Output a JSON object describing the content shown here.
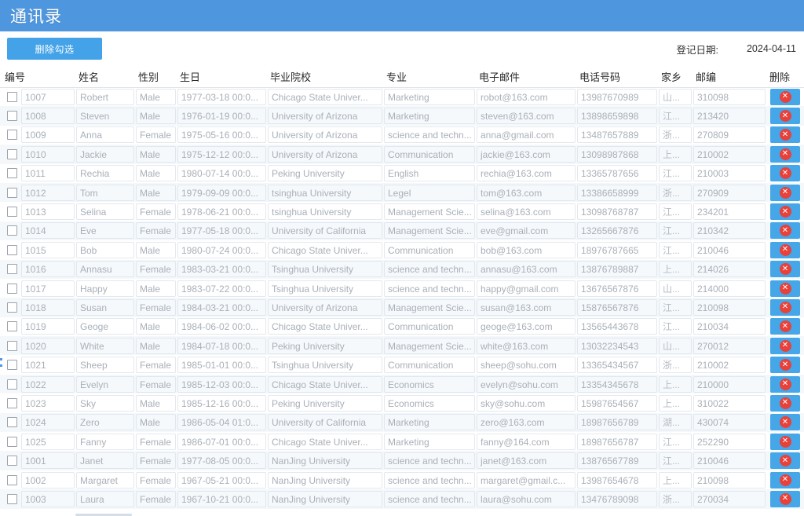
{
  "app": {
    "title": "通讯录",
    "accent_color": "#4e96de",
    "button_color": "#44a3e8",
    "delete_icon_color": "#e8413a"
  },
  "toolbar": {
    "delete_checked_label": "删除勾选",
    "reg_date_label": "登记日期:",
    "reg_date_value": "2024-04-11"
  },
  "table": {
    "columns": [
      {
        "key": "check",
        "label": "编号"
      },
      {
        "key": "name",
        "label": "姓名"
      },
      {
        "key": "gender",
        "label": "性别"
      },
      {
        "key": "birthday",
        "label": "生日"
      },
      {
        "key": "school",
        "label": "毕业院校"
      },
      {
        "key": "major",
        "label": "专业"
      },
      {
        "key": "email",
        "label": "电子邮件"
      },
      {
        "key": "phone",
        "label": "电话号码"
      },
      {
        "key": "hometown",
        "label": "家乡"
      },
      {
        "key": "zip",
        "label": "邮编"
      },
      {
        "key": "delete",
        "label": "删除"
      }
    ],
    "rows": [
      {
        "id": "1007",
        "name": "Robert",
        "gender": "Male",
        "birthday": "1977-03-18 00:0...",
        "school": "Chicago State Univer...",
        "major": "Marketing",
        "email": "robot@163.com",
        "phone": "13987670989",
        "hometown": "山...",
        "zip": "310098"
      },
      {
        "id": "1008",
        "name": "Steven",
        "gender": "Male",
        "birthday": "1976-01-19 00:0...",
        "school": "University of Arizona",
        "major": "Marketing",
        "email": "steven@163.com",
        "phone": "13898659898",
        "hometown": "江...",
        "zip": "213420"
      },
      {
        "id": "1009",
        "name": "Anna",
        "gender": "Female",
        "birthday": "1975-05-16 00:0...",
        "school": "University of Arizona",
        "major": "science and techn...",
        "email": "anna@gmail.com",
        "phone": "13487657889",
        "hometown": "浙...",
        "zip": "270809"
      },
      {
        "id": "1010",
        "name": "Jackie",
        "gender": "Male",
        "birthday": "1975-12-12 00:0...",
        "school": "University of Arizona",
        "major": "Communication",
        "email": "jackie@163.com",
        "phone": "13098987868",
        "hometown": "上...",
        "zip": "210002"
      },
      {
        "id": "1011",
        "name": "Rechia",
        "gender": "Male",
        "birthday": "1980-07-14 00:0...",
        "school": "Peking University",
        "major": "English",
        "email": "rechia@163.com",
        "phone": "13365787656",
        "hometown": "江...",
        "zip": "210003"
      },
      {
        "id": "1012",
        "name": "Tom",
        "gender": "Male",
        "birthday": "1979-09-09 00:0...",
        "school": "tsinghua University",
        "major": "Legel",
        "email": "tom@163.com",
        "phone": "13386658999",
        "hometown": "浙...",
        "zip": "270909"
      },
      {
        "id": "1013",
        "name": "Selina",
        "gender": "Female",
        "birthday": "1978-06-21 00:0...",
        "school": "tsinghua University",
        "major": "Management Scie...",
        "email": "selina@163.com",
        "phone": "13098768787",
        "hometown": "江...",
        "zip": "234201"
      },
      {
        "id": "1014",
        "name": "Eve",
        "gender": "Female",
        "birthday": "1977-05-18 00:0...",
        "school": "University of California",
        "major": "Management Scie...",
        "email": "eve@gmail.com",
        "phone": "13265667876",
        "hometown": "江...",
        "zip": "210342"
      },
      {
        "id": "1015",
        "name": "Bob",
        "gender": "Male",
        "birthday": "1980-07-24 00:0...",
        "school": "Chicago State Univer...",
        "major": "Communication",
        "email": "bob@163.com",
        "phone": "18976787665",
        "hometown": "江...",
        "zip": "210046"
      },
      {
        "id": "1016",
        "name": "Annasu",
        "gender": "Female",
        "birthday": "1983-03-21 00:0...",
        "school": "Tsinghua University",
        "major": "science and techn...",
        "email": "annasu@163.com",
        "phone": "13876789887",
        "hometown": "上...",
        "zip": "214026"
      },
      {
        "id": "1017",
        "name": "Happy",
        "gender": "Male",
        "birthday": "1983-07-22 00:0...",
        "school": "Tsinghua University",
        "major": "science and techn...",
        "email": "happy@gmail.com",
        "phone": "13676567876",
        "hometown": "山...",
        "zip": "214000"
      },
      {
        "id": "1018",
        "name": "Susan",
        "gender": "Female",
        "birthday": "1984-03-21 00:0...",
        "school": "University of Arizona",
        "major": "Management Scie...",
        "email": "susan@163.com",
        "phone": "15876567876",
        "hometown": "江...",
        "zip": "210098"
      },
      {
        "id": "1019",
        "name": "Geoge",
        "gender": "Male",
        "birthday": "1984-06-02 00:0...",
        "school": "Chicago State Univer...",
        "major": "Communication",
        "email": "geoge@163.com",
        "phone": "13565443678",
        "hometown": "江...",
        "zip": "210034"
      },
      {
        "id": "1020",
        "name": "White",
        "gender": "Male",
        "birthday": "1984-07-18 00:0...",
        "school": "Peking University",
        "major": "Management Scie...",
        "email": "white@163.com",
        "phone": "13032234543",
        "hometown": "山...",
        "zip": "270012"
      },
      {
        "id": "1021",
        "name": "Sheep",
        "gender": "Female",
        "birthday": "1985-01-01 00:0...",
        "school": "Tsinghua University",
        "major": "Communication",
        "email": "sheep@sohu.com",
        "phone": "13365434567",
        "hometown": "浙...",
        "zip": "210002"
      },
      {
        "id": "1022",
        "name": "Evelyn",
        "gender": "Female",
        "birthday": "1985-12-03 00:0...",
        "school": "Chicago State Univer...",
        "major": "Economics",
        "email": "evelyn@sohu.com",
        "phone": "13354345678",
        "hometown": "上...",
        "zip": "210000"
      },
      {
        "id": "1023",
        "name": "Sky",
        "gender": "Male",
        "birthday": "1985-12-16 00:0...",
        "school": "Peking University",
        "major": "Economics",
        "email": "sky@sohu.com",
        "phone": "15987654567",
        "hometown": "上...",
        "zip": "310022"
      },
      {
        "id": "1024",
        "name": "Zero",
        "gender": "Male",
        "birthday": "1986-05-04 01:0...",
        "school": "University of California",
        "major": "Marketing",
        "email": "zero@163.com",
        "phone": "18987656789",
        "hometown": "湖...",
        "zip": "430074"
      },
      {
        "id": "1025",
        "name": "Fanny",
        "gender": "Female",
        "birthday": "1986-07-01 00:0...",
        "school": "Chicago State Univer...",
        "major": "Marketing",
        "email": "fanny@164.com",
        "phone": "18987656787",
        "hometown": "江...",
        "zip": "252290"
      },
      {
        "id": "1001",
        "name": "Janet",
        "gender": "Female",
        "birthday": "1977-08-05 00:0...",
        "school": "NanJing University",
        "major": "science and techn...",
        "email": "janet@163.com",
        "phone": "13876567789",
        "hometown": "江...",
        "zip": "210046"
      },
      {
        "id": "1002",
        "name": "Margaret",
        "gender": "Female",
        "birthday": "1967-05-21 00:0...",
        "school": "NanJing University",
        "major": "science and techn...",
        "email": "margaret@gmail.c...",
        "phone": "13987654678",
        "hometown": "上...",
        "zip": "210098"
      },
      {
        "id": "1003",
        "name": "Laura",
        "gender": "Female",
        "birthday": "1967-10-21 00:0...",
        "school": "NanJing University",
        "major": "science and techn...",
        "email": "laura@sohu.com",
        "phone": "13476789098",
        "hometown": "浙...",
        "zip": "270034"
      }
    ],
    "delete_icon": "✕"
  }
}
